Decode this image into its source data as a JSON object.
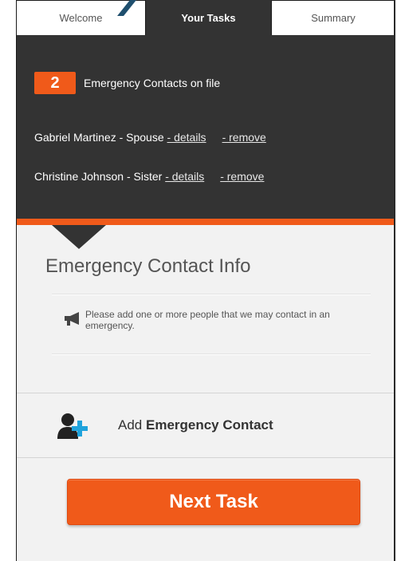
{
  "tabs": [
    {
      "label": "Welcome"
    },
    {
      "label": "Your Tasks"
    },
    {
      "label": "Summary"
    }
  ],
  "contacts_summary": {
    "count": "2",
    "label": "Emergency Contacts on file"
  },
  "contacts": [
    {
      "text": "Gabriel Martinez - Spouse",
      "details_link": "- details",
      "remove_link": "- remove"
    },
    {
      "text": "Christine Johnson - Sister",
      "details_link": "- details",
      "remove_link": "- remove"
    }
  ],
  "section": {
    "title": "Emergency Contact Info",
    "note": "Please add one or more people that we may contact in an emergency."
  },
  "add_contact": {
    "prefix": "Add",
    "bold": "Emergency Contact"
  },
  "next_button": "Next Task",
  "colors": {
    "accent": "#f05a1a",
    "dark_panel": "#333333",
    "add_icon_plus": "#1fa3dc"
  },
  "icons": {
    "note": "megaphone-icon",
    "add_contact": "add-person-icon"
  }
}
